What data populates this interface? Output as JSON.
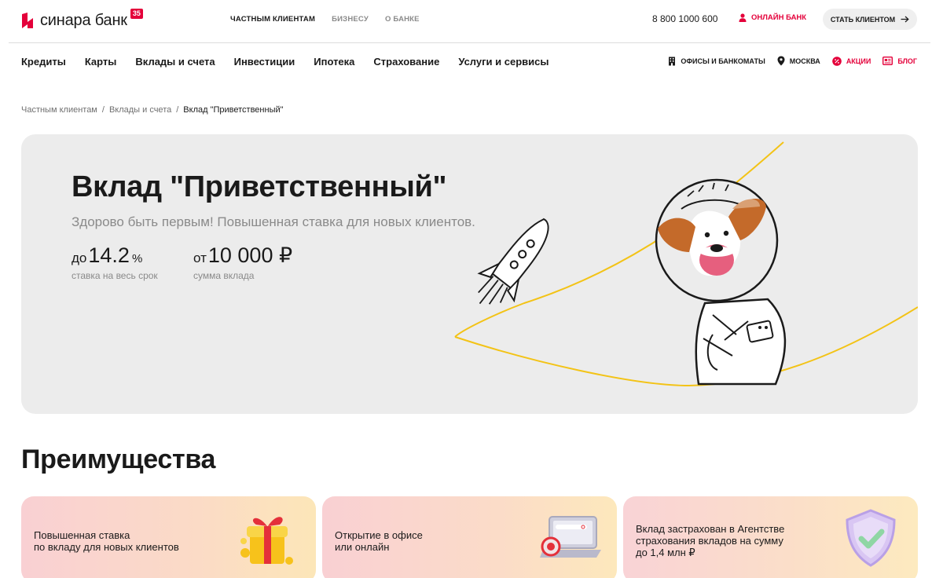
{
  "header": {
    "logo_text": "синара банк",
    "logo_badge": "35",
    "top_nav": [
      "ЧАСТНЫМ КЛИЕНТАМ",
      "БИЗНЕСУ",
      "О БАНКЕ"
    ],
    "phone": "8 800 1000 600",
    "online_bank": "ОНЛАЙН БАНК",
    "become_client": "СТАТЬ КЛИЕНТОМ"
  },
  "main_nav": {
    "items": [
      "Кредиты",
      "Карты",
      "Вклады и счета",
      "Инвестиции",
      "Ипотека",
      "Страхование",
      "Услуги и сервисы"
    ],
    "utility": {
      "offices": "ОФИСЫ И БАНКОМАТЫ",
      "city": "МОСКВА",
      "promos": "АКЦИИ",
      "blog": "БЛОГ"
    }
  },
  "breadcrumb": [
    "Частным клиентам",
    "/",
    "Вклады и счета",
    "/",
    "Вклад \"Приветственный\""
  ],
  "hero": {
    "title": "Вклад \"Приветственный\"",
    "subtitle": "Здорово быть первым! Повышенная ставка для новых клиентов.",
    "rate_prefix": "до",
    "rate_value": "14.2",
    "rate_unit": "%",
    "rate_caption": "ставка на весь срок",
    "amount_prefix": "от",
    "amount_value": "10 000 ₽",
    "amount_caption": "сумма вклада"
  },
  "advantages": {
    "title": "Преимущества",
    "cards": [
      {
        "line1": "Повышенная ставка",
        "line2": "по вкладу для новых клиентов",
        "line3": ""
      },
      {
        "line1": "Открытие в офисе",
        "line2": "или онлайн",
        "line3": ""
      },
      {
        "line1": "Вклад застрахован в Агентстве",
        "line2": "страхования вкладов на сумму",
        "line3": "до 1,4 млн ₽"
      }
    ]
  },
  "colors": {
    "brand_red": "#e4003a",
    "hero_bg": "#ececec",
    "orbit_yellow": "#f3c316"
  },
  "icons": [
    "logo-mark-icon",
    "user-icon",
    "arrow-right-icon",
    "building-icon",
    "location-pin-icon",
    "percent-badge-icon",
    "blog-icon",
    "rocket-icon",
    "astronaut-dog-image",
    "gift-box-image",
    "laptop-image",
    "shield-check-image"
  ]
}
